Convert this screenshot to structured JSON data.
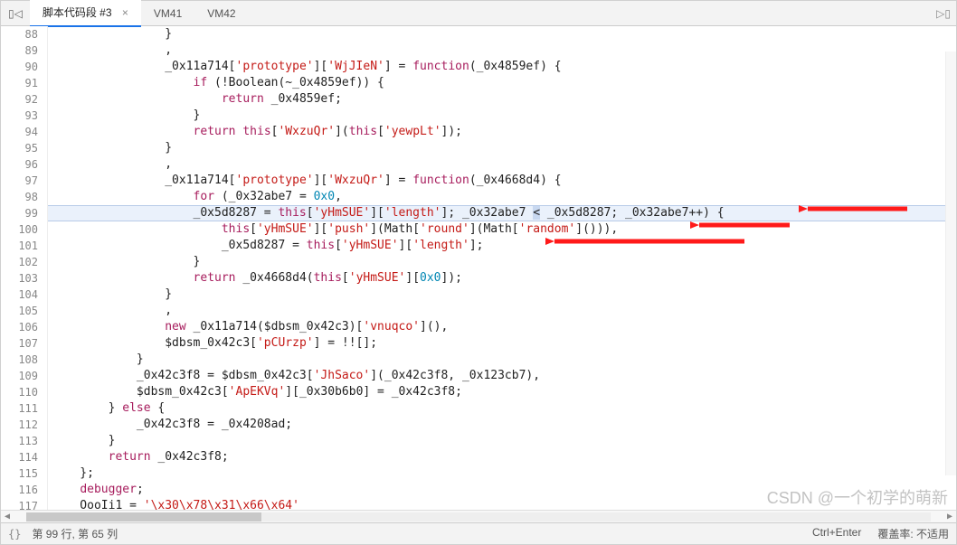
{
  "tabs": {
    "nav_prev": "◁",
    "nav_first": "▯◁",
    "active": {
      "label": "脚本代码段 #3",
      "close": "×"
    },
    "items": [
      "VM41",
      "VM42"
    ],
    "nav_next": "▷▯"
  },
  "gutter": {
    "start": 88,
    "end": 117
  },
  "code": {
    "l88": "                }",
    "l89": "                ,",
    "l90_a": "                _0x11a714[",
    "l90_s1": "'prototype'",
    "l90_b": "][",
    "l90_s2": "'WjJIeN'",
    "l90_c": "] = ",
    "l90_kw": "function",
    "l90_d": "(_0x4859ef) {",
    "l91_a": "                    ",
    "l91_kw": "if",
    "l91_b": " (!Boolean(~_0x4859ef)) {",
    "l92_a": "                        ",
    "l92_kw": "return",
    "l92_b": " _0x4859ef;",
    "l93": "                    }",
    "l94_a": "                    ",
    "l94_kw": "return",
    "l94_b": " ",
    "l94_this": "this",
    "l94_c": "[",
    "l94_s1": "'WxzuQr'",
    "l94_d": "](",
    "l94_this2": "this",
    "l94_e": "[",
    "l94_s2": "'yewpLt'",
    "l94_f": "]);",
    "l95": "                }",
    "l96": "                ,",
    "l97_a": "                _0x11a714[",
    "l97_s1": "'prototype'",
    "l97_b": "][",
    "l97_s2": "'WxzuQr'",
    "l97_c": "] = ",
    "l97_kw": "function",
    "l97_d": "(_0x4668d4) {",
    "l98_a": "                    ",
    "l98_kw": "for",
    "l98_b": " (_0x32abe7 = ",
    "l98_n": "0x0",
    "l98_c": ",",
    "l99_a": "                    _0x5d8287 = ",
    "l99_this": "this",
    "l99_b": "[",
    "l99_s1": "'yHmSUE'",
    "l99_c": "][",
    "l99_s2": "'length'",
    "l99_d": "]; _0x32abe7 ",
    "l99_lt": "<",
    "l99_e": " _0x5d8287; _0x32abe7++) {",
    "l100_a": "                        ",
    "l100_this": "this",
    "l100_b": "[",
    "l100_s1": "'yHmSUE'",
    "l100_c": "][",
    "l100_s2": "'push'",
    "l100_d": "](Math[",
    "l100_s3": "'round'",
    "l100_e": "](Math[",
    "l100_s4": "'random'",
    "l100_f": "]())),",
    "l101_a": "                        _0x5d8287 = ",
    "l101_this": "this",
    "l101_b": "[",
    "l101_s1": "'yHmSUE'",
    "l101_c": "][",
    "l101_s2": "'length'",
    "l101_d": "];",
    "l102": "                    }",
    "l103_a": "                    ",
    "l103_kw": "return",
    "l103_b": " _0x4668d4(",
    "l103_this": "this",
    "l103_c": "[",
    "l103_s1": "'yHmSUE'",
    "l103_d": "][",
    "l103_n": "0x0",
    "l103_e": "]);",
    "l104": "                }",
    "l105": "                ,",
    "l106_a": "                ",
    "l106_kw": "new",
    "l106_b": " _0x11a714($dbsm_0x42c3)[",
    "l106_s1": "'vnuqco'",
    "l106_c": "](),",
    "l107_a": "                $dbsm_0x42c3[",
    "l107_s1": "'pCUrzp'",
    "l107_b": "] = !![];",
    "l108": "            }",
    "l109_a": "            _0x42c3f8 = $dbsm_0x42c3[",
    "l109_s1": "'JhSaco'",
    "l109_b": "](_0x42c3f8, _0x123cb7),",
    "l110_a": "            $dbsm_0x42c3[",
    "l110_s1": "'ApEKVq'",
    "l110_b": "][_0x30b6b0] = _0x42c3f8;",
    "l111_a": "        } ",
    "l111_kw": "else",
    "l111_b": " {",
    "l112": "            _0x42c3f8 = _0x4208ad;",
    "l113": "        }",
    "l114_a": "        ",
    "l114_kw": "return",
    "l114_b": " _0x42c3f8;",
    "l115": "    };",
    "l116_a": "    ",
    "l116_kw": "debugger",
    "l116_b": ";",
    "l117_a": "    OooIi1 = ",
    "l117_s": "'\\x30\\x78\\x31\\x66\\x64'"
  },
  "status": {
    "braces": "{}",
    "pos": "第 99 行, 第 65 列",
    "shortcut": "Ctrl+Enter",
    "cover": "覆盖率: 不适用"
  },
  "watermark": "CSDN @一个初学的萌新"
}
